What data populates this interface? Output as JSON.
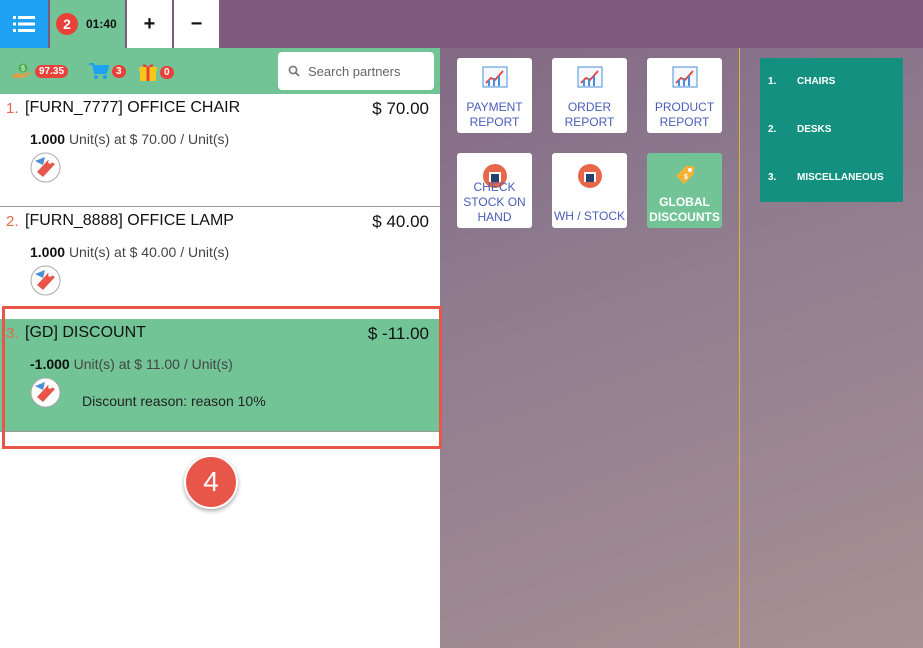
{
  "topbar": {
    "menu_icon": "list-icon",
    "order_number": "2",
    "order_time": "01:40",
    "add_label": "+",
    "remove_label": "−"
  },
  "header": {
    "loyalty_points": "97.35",
    "cart_count": "3",
    "gift_count": "0",
    "search_placeholder": "Search partners"
  },
  "orderlines": [
    {
      "num": "1.",
      "name": "[FURN_7777] OFFICE CHAIR",
      "price": "$ 70.00",
      "qty": "1.000",
      "unit_text": "Unit(s) at $ 70.00 / Unit(s)",
      "note": ""
    },
    {
      "num": "2.",
      "name": "[FURN_8888] OFFICE LAMP",
      "price": "$ 40.00",
      "qty": "1.000",
      "unit_text": "Unit(s) at $ 40.00 / Unit(s)",
      "note": ""
    },
    {
      "num": "3.",
      "name": "[GD] DISCOUNT",
      "price": "$ -11.00",
      "qty": "-1.000",
      "unit_text": "Unit(s) at $ 11.00 / Unit(s)",
      "note": "Discount reason: reason 10%"
    }
  ],
  "step_marker": "4",
  "actions": [
    {
      "line1": "PAYMENT",
      "line2": "REPORT",
      "line3": ""
    },
    {
      "line1": "ORDER",
      "line2": "REPORT",
      "line3": ""
    },
    {
      "line1": "PRODUCT",
      "line2": "REPORT",
      "line3": ""
    },
    {
      "line1": "CHECK",
      "line2": "STOCK ON",
      "line3": "HAND"
    },
    {
      "line1": "WH / STOCK",
      "line2": "",
      "line3": ""
    },
    {
      "line1": "GLOBAL",
      "line2": "DISCOUNTS",
      "line3": ""
    }
  ],
  "categories": [
    {
      "num": "1.",
      "label": "CHAIRS"
    },
    {
      "num": "2.",
      "label": "DESKS"
    },
    {
      "num": "3.",
      "label": "MISCELLANEOUS"
    }
  ],
  "colors": {
    "accent_green": "#72c497",
    "badge_red": "#e8413a",
    "menu_blue": "#1ea1f2",
    "category_teal": "#13907f"
  }
}
